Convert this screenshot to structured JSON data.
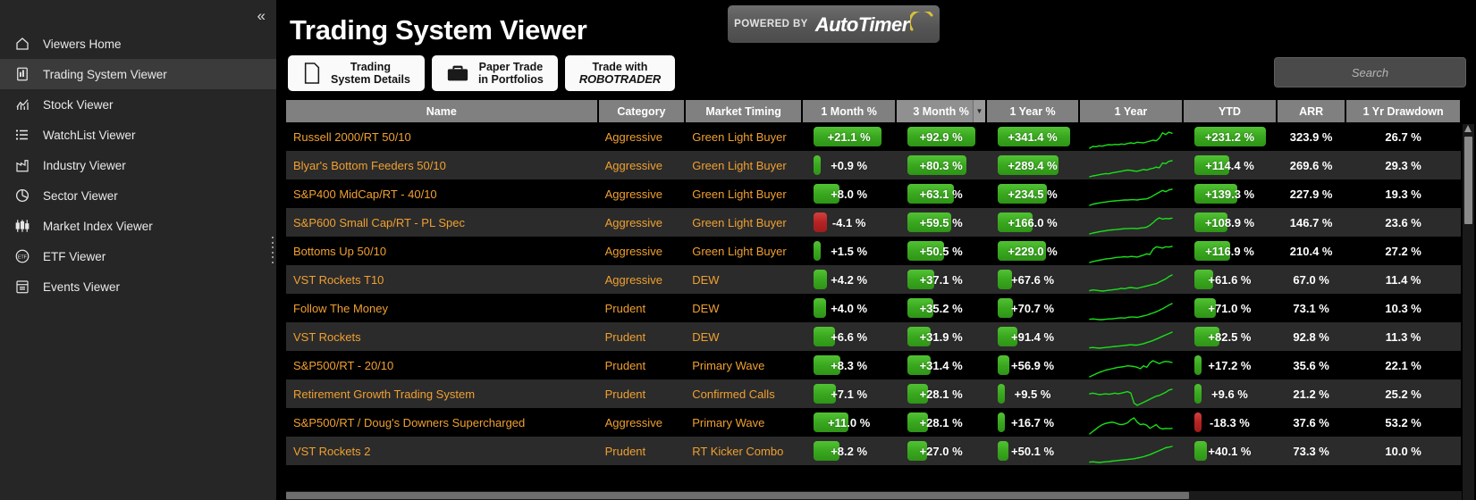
{
  "sidebar": {
    "collapse_label": "«",
    "items": [
      {
        "label": "Viewers Home",
        "icon": "home-icon",
        "active": false
      },
      {
        "label": "Trading System Viewer",
        "icon": "clipboard-chart-icon",
        "active": true
      },
      {
        "label": "Stock Viewer",
        "icon": "stock-chart-icon",
        "active": false
      },
      {
        "label": "WatchList Viewer",
        "icon": "list-icon",
        "active": false
      },
      {
        "label": "Industry Viewer",
        "icon": "factory-icon",
        "active": false
      },
      {
        "label": "Sector Viewer",
        "icon": "pie-chart-icon",
        "active": false
      },
      {
        "label": "Market Index Viewer",
        "icon": "candlestick-icon",
        "active": false
      },
      {
        "label": "ETF Viewer",
        "icon": "etf-circle-icon",
        "active": false
      },
      {
        "label": "Events Viewer",
        "icon": "calendar-icon",
        "active": false
      }
    ]
  },
  "header": {
    "title": "Trading System Viewer",
    "powered_by": "POWERED BY",
    "brand_part1": "Auto",
    "brand_part2": "Timer",
    "buttons": [
      {
        "line1": "Trading",
        "line2": "System Details",
        "icon": "document-icon"
      },
      {
        "line1": "Paper Trade",
        "line2": "in Portfolios",
        "icon": "briefcase-icon"
      },
      {
        "line1": "Trade with",
        "line2": "ROBOTRADER",
        "line2_a": "ROBO",
        "line2_b": "TRADER",
        "icon": "none"
      }
    ]
  },
  "search": {
    "placeholder": "Search",
    "value": ""
  },
  "table": {
    "columns": [
      {
        "key": "name",
        "label": "Name",
        "sorted": false
      },
      {
        "key": "category",
        "label": "Category",
        "sorted": false
      },
      {
        "key": "timing",
        "label": "Market Timing",
        "sorted": false
      },
      {
        "key": "m1",
        "label": "1 Month %",
        "sorted": false
      },
      {
        "key": "m3",
        "label": "3 Month %",
        "sorted": true
      },
      {
        "key": "y1p",
        "label": "1 Year %",
        "sorted": false
      },
      {
        "key": "y1",
        "label": "1 Year",
        "sorted": false
      },
      {
        "key": "ytd",
        "label": "YTD",
        "sorted": false
      },
      {
        "key": "arr",
        "label": "ARR",
        "sorted": false
      },
      {
        "key": "dd",
        "label": "1 Yr Drawdown",
        "sorted": false
      }
    ],
    "sort_caret": "▼",
    "rows": [
      {
        "name": "Russell 2000/RT 50/10",
        "category": "Aggressive",
        "timing": "Green Light Buyer",
        "m1": "+21.1 %",
        "m1_v": 21.1,
        "m3": "+92.9 %",
        "m3_v": 92.9,
        "y1p": "+341.4 %",
        "y1p_v": 341.4,
        "ytd": "+231.2 %",
        "ytd_v": 231.2,
        "arr": "323.9 %",
        "dd": "26.7 %",
        "spark": [
          6,
          12,
          11,
          14,
          13,
          16,
          18,
          17,
          19,
          18,
          20,
          19,
          22,
          24,
          22,
          26,
          25,
          24,
          27,
          30,
          33,
          31,
          40,
          58,
          52,
          60,
          56
        ]
      },
      {
        "name": "Blyar's Bottom Feeders 50/10",
        "category": "Aggressive",
        "timing": "Green Light Buyer",
        "m1": "+0.9 %",
        "m1_v": 0.9,
        "m3": "+80.3 %",
        "m3_v": 80.3,
        "y1p": "+289.4 %",
        "y1p_v": 289.4,
        "ytd": "+114.4 %",
        "ytd_v": 114.4,
        "arr": "269.6 %",
        "dd": "29.3 %",
        "spark": [
          5,
          8,
          10,
          12,
          14,
          16,
          15,
          18,
          20,
          22,
          24,
          26,
          28,
          27,
          25,
          24,
          27,
          30,
          28,
          32,
          34,
          38,
          36,
          52,
          50,
          58,
          60
        ]
      },
      {
        "name": "S&P400 MidCap/RT - 40/10",
        "category": "Aggressive",
        "timing": "Green Light Buyer",
        "m1": "+8.0 %",
        "m1_v": 8.0,
        "m3": "+63.1 %",
        "m3_v": 63.1,
        "y1p": "+234.5 %",
        "y1p_v": 234.5,
        "ytd": "+139.3 %",
        "ytd_v": 139.3,
        "arr": "227.9 %",
        "dd": "19.3 %",
        "spark": [
          6,
          10,
          12,
          14,
          16,
          17,
          19,
          20,
          21,
          22,
          23,
          24,
          24,
          25,
          25,
          24,
          26,
          27,
          28,
          32,
          38,
          44,
          50,
          56,
          52,
          58,
          60
        ]
      },
      {
        "name": "S&P600 Small Cap/RT - PL Spec",
        "category": "Aggressive",
        "timing": "Green Light Buyer",
        "m1": "-4.1 %",
        "m1_v": -4.1,
        "m3": "+59.5 %",
        "m3_v": 59.5,
        "y1p": "+166.0 %",
        "y1p_v": 166.0,
        "ytd": "+108.9 %",
        "ytd_v": 108.9,
        "arr": "146.7 %",
        "dd": "23.6 %",
        "spark": [
          6,
          9,
          11,
          13,
          15,
          16,
          18,
          19,
          20,
          21,
          22,
          23,
          23,
          24,
          24,
          23,
          25,
          26,
          28,
          34,
          42,
          52,
          58,
          54,
          56,
          55,
          57
        ]
      },
      {
        "name": "Bottoms Up 50/10",
        "category": "Aggressive",
        "timing": "Green Light Buyer",
        "m1": "+1.5 %",
        "m1_v": 1.5,
        "m3": "+50.5 %",
        "m3_v": 50.5,
        "y1p": "+229.0 %",
        "y1p_v": 229.0,
        "ytd": "+116.9 %",
        "ytd_v": 116.9,
        "arr": "210.4 %",
        "dd": "27.2 %",
        "spark": [
          5,
          8,
          10,
          12,
          14,
          16,
          17,
          18,
          20,
          21,
          22,
          23,
          22,
          24,
          23,
          22,
          25,
          28,
          32,
          30,
          46,
          54,
          52,
          50,
          54,
          53,
          55
        ]
      },
      {
        "name": "VST Rockets T10",
        "category": "Aggressive",
        "timing": "DEW",
        "m1": "+4.2 %",
        "m1_v": 4.2,
        "m3": "+37.1 %",
        "m3_v": 37.1,
        "y1p": "+67.6 %",
        "y1p_v": 67.6,
        "ytd": "+61.6 %",
        "ytd_v": 61.6,
        "arr": "67.0 %",
        "dd": "11.4 %",
        "spark": [
          12,
          14,
          13,
          12,
          11,
          12,
          13,
          14,
          15,
          16,
          18,
          17,
          19,
          20,
          19,
          18,
          20,
          22,
          24,
          26,
          28,
          30,
          34,
          38,
          42,
          48,
          52
        ]
      },
      {
        "name": "Follow The Money",
        "category": "Prudent",
        "timing": "DEW",
        "m1": "+4.0 %",
        "m1_v": 4.0,
        "m3": "+35.2 %",
        "m3_v": 35.2,
        "y1p": "+70.7 %",
        "y1p_v": 70.7,
        "ytd": "+71.0 %",
        "ytd_v": 71.0,
        "arr": "73.1 %",
        "dd": "10.3 %",
        "spark": [
          12,
          13,
          12,
          11,
          11,
          12,
          13,
          13,
          14,
          15,
          16,
          15,
          17,
          18,
          18,
          17,
          19,
          21,
          23,
          26,
          29,
          32,
          36,
          40,
          45,
          50,
          54
        ]
      },
      {
        "name": "VST Rockets",
        "category": "Prudent",
        "timing": "DEW",
        "m1": "+6.6 %",
        "m1_v": 6.6,
        "m3": "+31.9 %",
        "m3_v": 31.9,
        "y1p": "+91.4 %",
        "y1p_v": 91.4,
        "ytd": "+82.5 %",
        "ytd_v": 82.5,
        "arr": "92.8 %",
        "dd": "11.3 %",
        "spark": [
          11,
          12,
          11,
          10,
          11,
          12,
          13,
          14,
          15,
          16,
          17,
          18,
          19,
          20,
          19,
          19,
          21,
          23,
          26,
          29,
          32,
          36,
          40,
          44,
          48,
          52,
          56
        ]
      },
      {
        "name": "S&P500/RT - 20/10",
        "category": "Prudent",
        "timing": "Primary Wave",
        "m1": "+8.3 %",
        "m1_v": 8.3,
        "m3": "+31.4 %",
        "m3_v": 31.4,
        "y1p": "+56.9 %",
        "y1p_v": 56.9,
        "ytd": "+17.2 %",
        "ytd_v": 17.2,
        "arr": "35.6 %",
        "dd": "22.1 %",
        "spark": [
          8,
          12,
          16,
          20,
          23,
          26,
          28,
          30,
          32,
          34,
          35,
          36,
          38,
          37,
          36,
          34,
          30,
          38,
          34,
          46,
          52,
          48,
          44,
          48,
          50,
          49,
          47
        ]
      },
      {
        "name": "Retirement Growth Trading System",
        "category": "Prudent",
        "timing": "Confirmed Calls",
        "m1": "+7.1 %",
        "m1_v": 7.1,
        "m3": "+28.1 %",
        "m3_v": 28.1,
        "y1p": "+9.5 %",
        "y1p_v": 9.5,
        "ytd": "+9.6 %",
        "ytd_v": 9.6,
        "arr": "21.2 %",
        "dd": "25.2 %",
        "spark": [
          44,
          46,
          44,
          42,
          43,
          44,
          43,
          44,
          46,
          44,
          46,
          48,
          50,
          46,
          20,
          14,
          18,
          22,
          26,
          30,
          34,
          38,
          40,
          44,
          48,
          54,
          56
        ]
      },
      {
        "name": "S&P500/RT / Doug's Downers Supercharged",
        "category": "Aggressive",
        "timing": "Primary Wave",
        "m1": "+11.0 %",
        "m1_v": 11.0,
        "m3": "+28.1 %",
        "m3_v": 28.1,
        "y1p": "+16.7 %",
        "y1p_v": 16.7,
        "ytd": "-18.3 %",
        "ytd_v": -18.3,
        "arr": "37.6 %",
        "dd": "53.2 %",
        "spark": [
          10,
          18,
          26,
          34,
          40,
          44,
          46,
          48,
          46,
          42,
          40,
          42,
          46,
          56,
          62,
          48,
          40,
          42,
          38,
          28,
          34,
          40,
          30,
          26,
          28,
          27,
          28
        ]
      },
      {
        "name": "VST Rockets 2",
        "category": "Prudent",
        "timing": "RT Kicker Combo",
        "m1": "+8.2 %",
        "m1_v": 8.2,
        "m3": "+27.0 %",
        "m3_v": 27.0,
        "y1p": "+50.1 %",
        "y1p_v": 50.1,
        "ytd": "+40.1 %",
        "ytd_v": 40.1,
        "arr": "73.3 %",
        "dd": "10.0 %",
        "spark": [
          14,
          15,
          14,
          13,
          14,
          15,
          16,
          17,
          18,
          19,
          20,
          21,
          22,
          23,
          24,
          26,
          28,
          30,
          33,
          36,
          40,
          44,
          48,
          52,
          56,
          58,
          60
        ]
      }
    ]
  },
  "colors": {
    "accent_orange": "#f0a030",
    "bar_positive": "#3aa81f",
    "bar_negative": "#b52323",
    "sparkline": "#19e019",
    "header_bg": "#808080",
    "sidebar_bg": "#262626"
  }
}
